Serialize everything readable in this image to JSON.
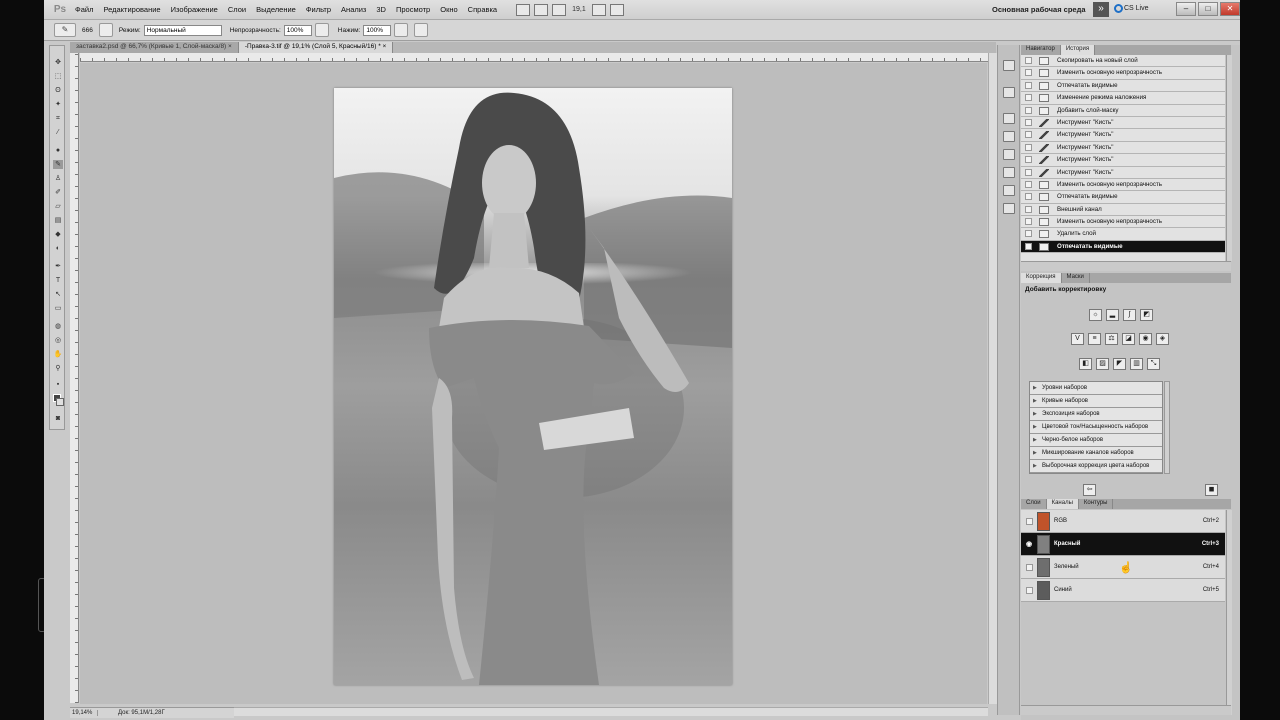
{
  "app": {
    "logo": "Ps",
    "menu": [
      "Файл",
      "Редактирование",
      "Изображение",
      "Слои",
      "Выделение",
      "Фильтр",
      "Анализ",
      "3D",
      "Просмотр",
      "Окно",
      "Справка"
    ],
    "zoom_menu": "19,1",
    "workspace": "Основная рабочая среда",
    "workspace_arrow": "»",
    "cs_live": "CS Live",
    "window_controls": [
      "–",
      "□",
      "✕"
    ]
  },
  "options": {
    "brush_size": "666",
    "mode_label": "Режим:",
    "mode_value": "Нормальный",
    "opacity_label": "Непрозрачность:",
    "opacity_value": "100%",
    "pressure_label": "Нажим:",
    "pressure_value": "100%"
  },
  "tabs": [
    {
      "label": "заставка2.psd @ 66,7% (Кривые 1, Слой-маска/8) ×",
      "active": false
    },
    {
      "label": "-Правка-3.tif @ 19,1% (Слой 5, Красный/16) * ×",
      "active": true
    }
  ],
  "status": {
    "zoom": "19,14%",
    "doc": "Док: 95,1M/1,28Г"
  },
  "history": {
    "tabs": [
      "Навигатор",
      "История"
    ],
    "items": [
      {
        "label": "Скопировать на новый слой",
        "kind": "doc",
        "selected": false
      },
      {
        "label": "Изменить основную непрозрачность",
        "kind": "doc",
        "selected": false
      },
      {
        "label": "Отпечатать видимые",
        "kind": "doc",
        "selected": false
      },
      {
        "label": "Изменение режима наложения",
        "kind": "doc",
        "selected": false
      },
      {
        "label": "Добавить слой-маску",
        "kind": "doc",
        "selected": false
      },
      {
        "label": "Инструмент \"Кисть\"",
        "kind": "brush",
        "selected": false
      },
      {
        "label": "Инструмент \"Кисть\"",
        "kind": "brush",
        "selected": false
      },
      {
        "label": "Инструмент \"Кисть\"",
        "kind": "brush",
        "selected": false
      },
      {
        "label": "Инструмент \"Кисть\"",
        "kind": "brush",
        "selected": false
      },
      {
        "label": "Инструмент \"Кисть\"",
        "kind": "brush",
        "selected": false
      },
      {
        "label": "Изменить основную непрозрачность",
        "kind": "doc",
        "selected": false
      },
      {
        "label": "Отпечатать видимые",
        "kind": "doc",
        "selected": false
      },
      {
        "label": "Внешний канал",
        "kind": "doc",
        "selected": false
      },
      {
        "label": "Изменить основную непрозрачность",
        "kind": "doc",
        "selected": false
      },
      {
        "label": "Удалить слой",
        "kind": "doc",
        "selected": false
      },
      {
        "label": "Отпечатать видимые",
        "kind": "doc",
        "selected": true
      }
    ]
  },
  "adjustments": {
    "tabs": [
      "Коррекция",
      "Маски"
    ],
    "title": "Добавить корректировку",
    "presets": [
      "Уровни наборов",
      "Кривые наборов",
      "Экспозиция наборов",
      "Цветовой тон/Насыщенность наборов",
      "Черно-белое наборов",
      "Микширование каналов наборов",
      "Выборочная коррекция цвета наборов"
    ]
  },
  "channels": {
    "tabs": [
      "Слои",
      "Каналы",
      "Контуры"
    ],
    "items": [
      {
        "name": "RGB",
        "shortcut": "Ctrl+2",
        "active": false,
        "thumb": "#c0532a"
      },
      {
        "name": "Красный",
        "shortcut": "Ctrl+3",
        "active": true,
        "thumb": "#808080"
      },
      {
        "name": "Зеленый",
        "shortcut": "Ctrl+4",
        "active": false,
        "thumb": "#6e6e6e"
      },
      {
        "name": "Синий",
        "shortcut": "Ctrl+5",
        "active": false,
        "thumb": "#5c5c5c"
      }
    ]
  },
  "colors": {
    "selected_row": "#111111",
    "canvas": "#bdbdbd"
  }
}
